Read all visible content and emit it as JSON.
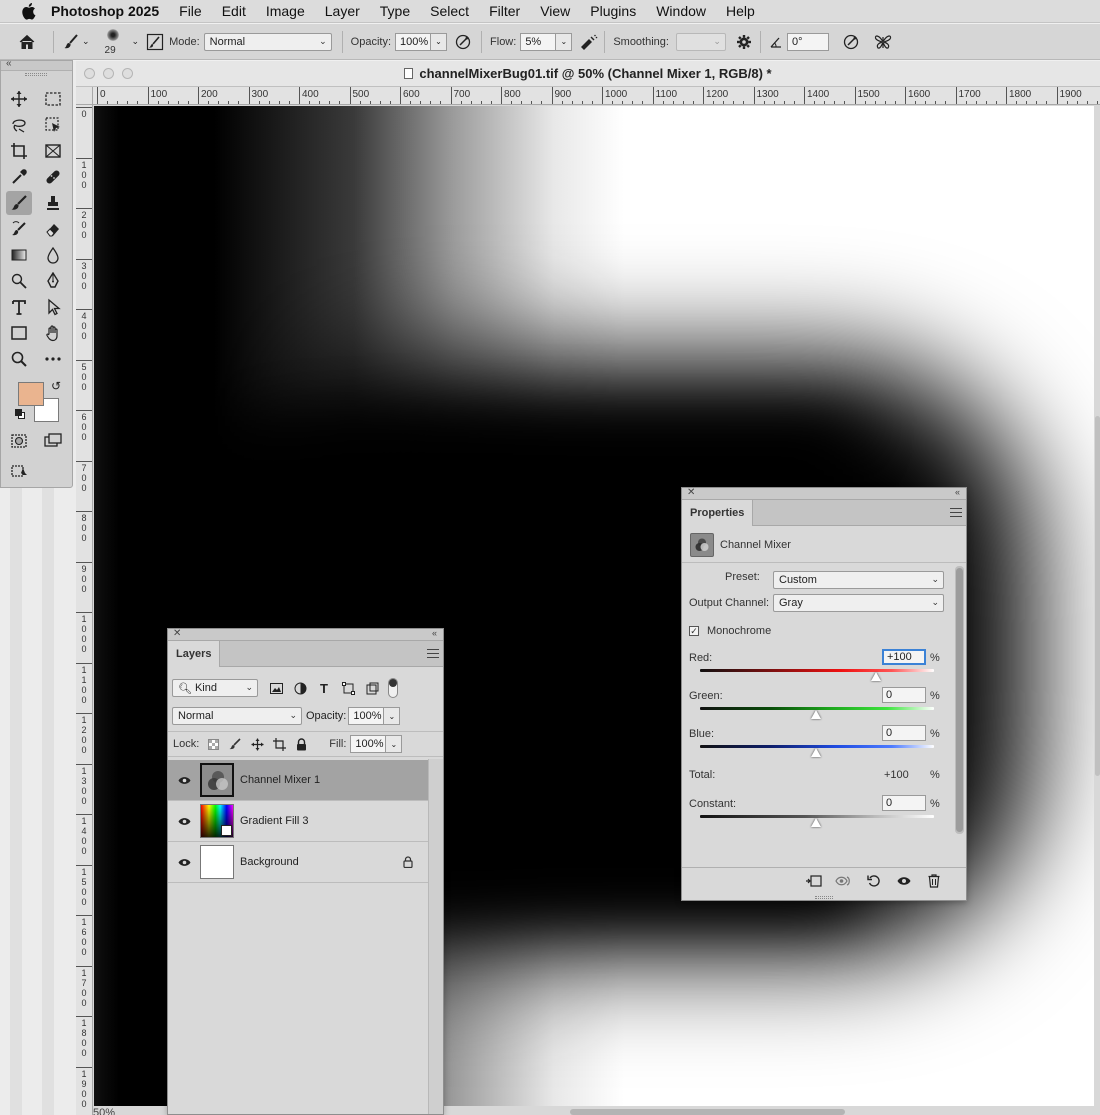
{
  "menubar": {
    "app_name": "Photoshop 2025",
    "items": [
      "File",
      "Edit",
      "Image",
      "Layer",
      "Type",
      "Select",
      "Filter",
      "View",
      "Plugins",
      "Window",
      "Help"
    ]
  },
  "options_bar": {
    "brush_size": "29",
    "mode_label": "Mode:",
    "mode_value": "Normal",
    "opacity_label": "Opacity:",
    "opacity_value": "100%",
    "flow_label": "Flow:",
    "flow_value": "5%",
    "smoothing_label": "Smoothing:",
    "smoothing_value": "",
    "angle_value": "0°"
  },
  "document": {
    "title": "channelMixerBug01.tif @ 50% (Channel Mixer 1, RGB/8) *",
    "zoom": "50%",
    "ruler_top": [
      "0",
      "100",
      "200",
      "300",
      "400",
      "500",
      "600",
      "700",
      "800",
      "900",
      "1000",
      "1100",
      "1200",
      "1300",
      "1400",
      "1500",
      "1600",
      "1700",
      "1800",
      "1900"
    ],
    "ruler_left": [
      "0",
      "100",
      "200",
      "300",
      "400",
      "500",
      "600",
      "700",
      "800",
      "900",
      "1000",
      "1100",
      "1200",
      "1300",
      "1400",
      "1500",
      "1600",
      "1700",
      "1800",
      "1900"
    ]
  },
  "toolbar": {
    "foreground_color": "#eab48f",
    "background_color": "#ffffff"
  },
  "layers_panel": {
    "tab": "Layers",
    "filter_kind": "Kind",
    "blend_mode": "Normal",
    "opacity_label": "Opacity:",
    "opacity_value": "100%",
    "lock_label": "Lock:",
    "fill_label": "Fill:",
    "fill_value": "100%",
    "layers": [
      {
        "name": "Channel Mixer 1",
        "selected": true,
        "icon": "channel-mixer-adjustment-icon"
      },
      {
        "name": "Gradient Fill 3",
        "selected": false,
        "icon": "gradient-fill-icon"
      },
      {
        "name": "Background",
        "selected": false,
        "icon": "white-thumbnail",
        "locked": true
      }
    ]
  },
  "properties_panel": {
    "tab": "Properties",
    "adjustment_name": "Channel Mixer",
    "preset_label": "Preset:",
    "preset_value": "Custom",
    "output_channel_label": "Output Channel:",
    "output_channel_value": "Gray",
    "monochrome_label": "Monochrome",
    "monochrome_checked": true,
    "red_label": "Red:",
    "red_value": "+100",
    "green_label": "Green:",
    "green_value": "0",
    "blue_label": "Blue:",
    "blue_value": "0",
    "total_label": "Total:",
    "total_value": "+100",
    "constant_label": "Constant:",
    "constant_value": "0",
    "percent": "%"
  }
}
